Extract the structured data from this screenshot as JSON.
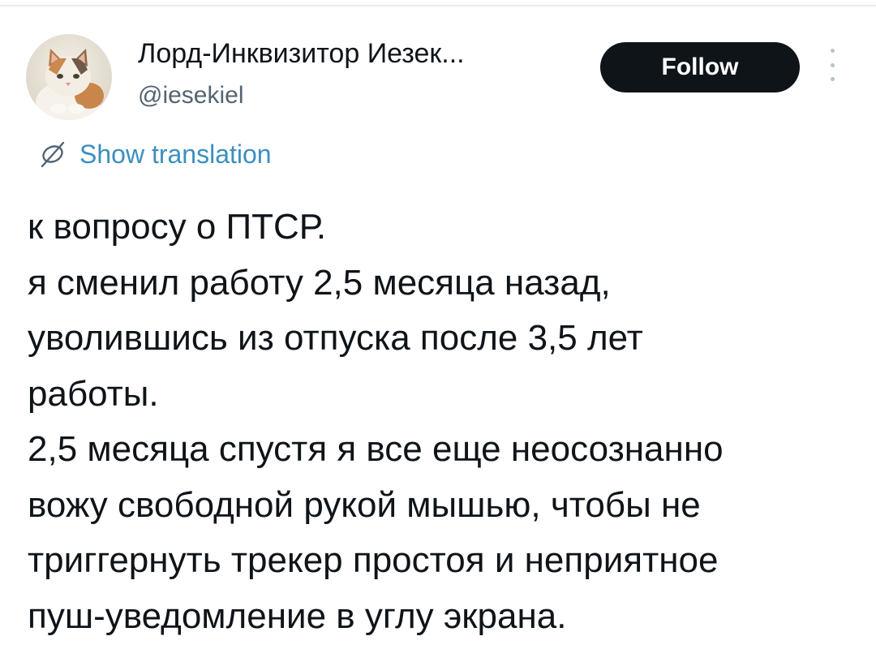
{
  "author": {
    "display_name": "Лорд-Инквизитор Иезек...",
    "handle": "@iesekiel",
    "avatar": "cat-photo-avatar"
  },
  "actions": {
    "follow_label": "Follow",
    "more_icon": "more-vertical-icon"
  },
  "translation": {
    "icon": "globe-slash-icon",
    "label": "Show translation"
  },
  "tweet": {
    "lines": [
      "к вопросу о ПТСР.",
      "я сменил работу 2,5 месяца назад,",
      "уволившись из отпуска после 3,5 лет",
      "работы.",
      "2,5 месяца спустя я все еще неосознанно",
      "вожу свободной рукой мышью, чтобы не",
      "триггернуть трекер простоя и неприятное",
      "пуш-уведомление в углу экрана."
    ]
  },
  "colors": {
    "text": "#0f1419",
    "secondary": "#536471",
    "link": "#3b8fbf",
    "button_bg": "#0f1419",
    "button_text": "#ffffff"
  }
}
